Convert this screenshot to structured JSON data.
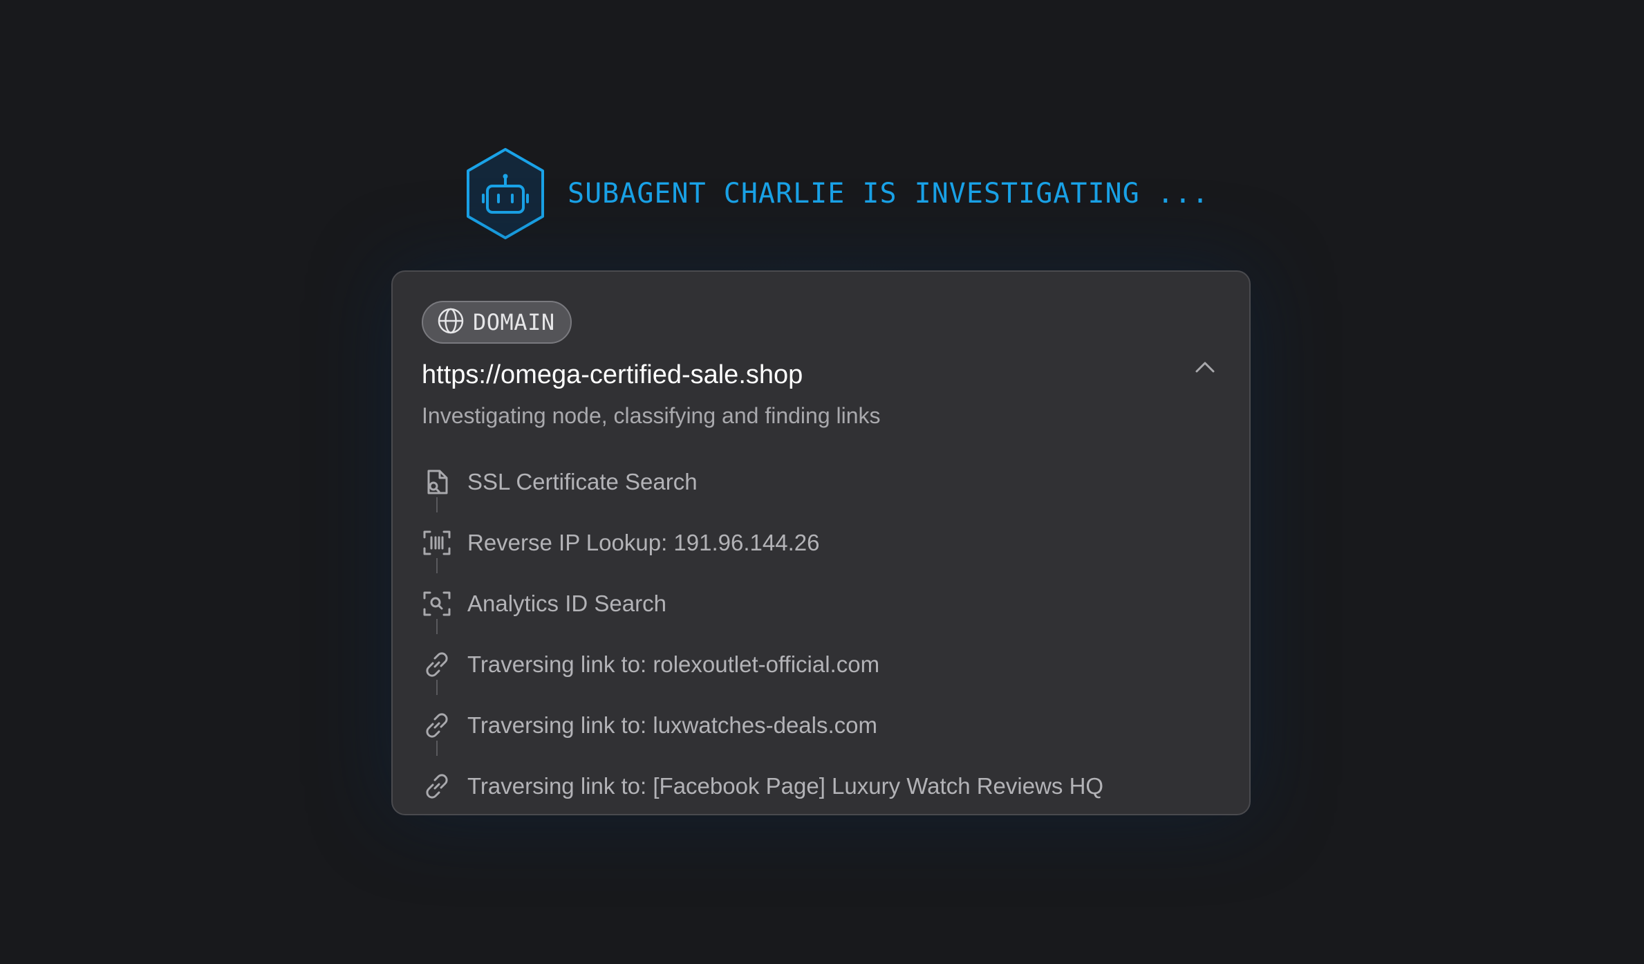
{
  "agent": {
    "status_text": "SUBAGENT CHARLIE IS INVESTIGATING ...",
    "icon": "robot-icon",
    "accent_color": "#1aa3e8"
  },
  "card": {
    "badge": {
      "icon": "globe-icon",
      "label": "DOMAIN"
    },
    "url": "https://omega-certified-sale.shop",
    "subtitle": "Investigating node, classifying and finding links",
    "collapse_icon": "chevron-up-icon",
    "steps": [
      {
        "icon": "file-search-icon",
        "label": "SSL Certificate Search"
      },
      {
        "icon": "barcode-scan-icon",
        "label": "Reverse IP Lookup: 191.96.144.26"
      },
      {
        "icon": "scan-search-icon",
        "label": "Analytics ID Search"
      },
      {
        "icon": "link-icon",
        "label": "Traversing link to: rolexoutlet-official.com"
      },
      {
        "icon": "link-icon",
        "label": "Traversing link to: luxwatches-deals.com"
      },
      {
        "icon": "link-icon",
        "label": "Traversing link to: [Facebook Page] Luxury Watch Reviews HQ"
      }
    ]
  }
}
